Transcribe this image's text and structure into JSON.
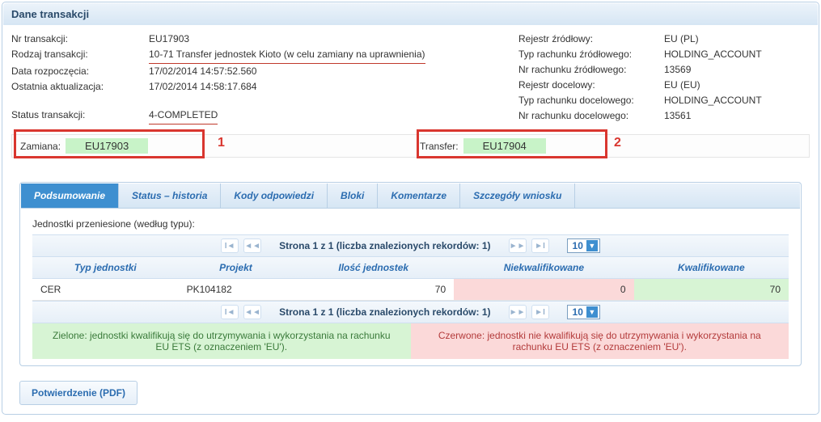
{
  "panel_title": "Dane transakcji",
  "left": {
    "nr_label": "Nr transakcji:",
    "nr_value": "EU17903",
    "type_label": "Rodzaj transakcji:",
    "type_value": "10-71 Transfer jednostek Kioto (w celu zamiany na uprawnienia)",
    "start_label": "Data rozpoczęcia:",
    "start_value": "17/02/2014 14:57:52.560",
    "update_label": "Ostatnia aktualizacja:",
    "update_value": "17/02/2014 14:58:17.684",
    "status_label": "Status transakcji:",
    "status_value": "4-COMPLETED"
  },
  "right": {
    "src_reg_label": "Rejestr źródłowy:",
    "src_reg_value": "EU (PL)",
    "src_type_label": "Typ rachunku źródłowego:",
    "src_type_value": "HOLDING_ACCOUNT",
    "src_acc_label": "Nr rachunku źródłowego:",
    "src_acc_value": "13569",
    "dst_reg_label": "Rejestr docelowy:",
    "dst_reg_value": "EU (EU)",
    "dst_type_label": "Typ rachunku docelowego:",
    "dst_type_value": "HOLDING_ACCOUNT",
    "dst_acc_label": "Nr rachunku docelowego:",
    "dst_acc_value": "13561"
  },
  "badges": {
    "zamiana_label": "Zamiana:",
    "zamiana_value": "EU17903",
    "annot1": "1",
    "transfer_label": "Transfer:",
    "transfer_value": "EU17904",
    "annot2": "2"
  },
  "tabs": [
    "Podsumowanie",
    "Status – historia",
    "Kody odpowiedzi",
    "Bloki",
    "Komentarze",
    "Szczegóły wniosku"
  ],
  "summary": {
    "title": "Jednostki przeniesione (według typu):",
    "pager_text": "Strona 1 z 1 (liczba znalezionych rekordów: 1)",
    "page_size": "10",
    "columns": [
      "Typ jednostki",
      "Projekt",
      "Ilość jednostek",
      "Niekwalifikowane",
      "Kwalifikowane"
    ],
    "row": {
      "type": "CER",
      "project": "PK104182",
      "qty": "70",
      "non_qual": "0",
      "qual": "70"
    },
    "legend_green": "Zielone: jednostki kwalifikują się do utrzymywania i wykorzystania na rachunku EU ETS (z oznaczeniem 'EU').",
    "legend_red": "Czerwone: jednostki nie kwalifikują się do utrzymywania i wykorzystania na rachunku EU ETS (z oznaczeniem 'EU')."
  },
  "pdf_button": "Potwierdzenie (PDF)"
}
